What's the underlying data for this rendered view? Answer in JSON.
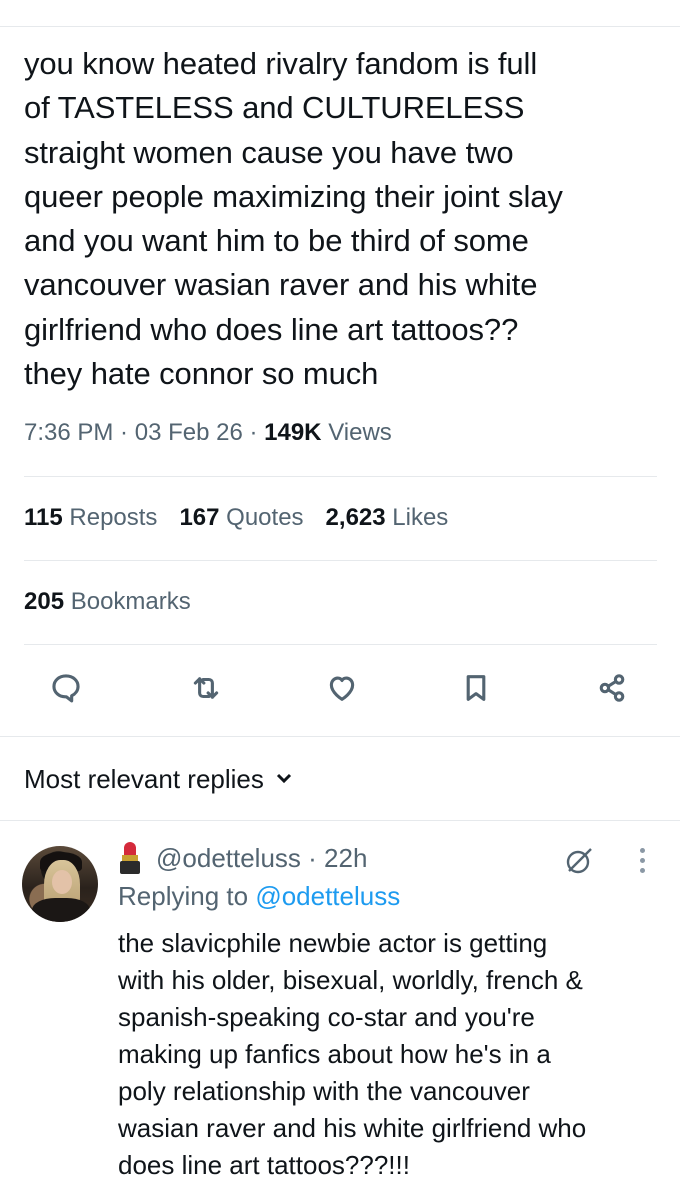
{
  "tweet": {
    "text": "you know heated rivalry fandom is full\nof TASTELESS and CULTURELESS\nstraight women cause you have two\nqueer people maximizing their joint slay\nand you want him to be third of some\nvancouver wasian raver and his white\ngirlfriend who does line art tattoos??\nthey hate connor so much",
    "time": "7:36 PM",
    "date": "03 Feb 26",
    "views_count": "149K",
    "views_label": "Views",
    "separator": " · "
  },
  "stats": {
    "reposts_count": "115",
    "reposts_label": "Reposts",
    "quotes_count": "167",
    "quotes_label": "Quotes",
    "likes_count": "2,623",
    "likes_label": "Likes",
    "bookmarks_count": "205",
    "bookmarks_label": "Bookmarks"
  },
  "actions": {
    "icons": [
      "reply-icon",
      "repost-icon",
      "like-icon",
      "bookmark-icon",
      "share-icon"
    ]
  },
  "replies": {
    "header_label": "Most relevant replies",
    "items": [
      {
        "handle": "@odetteluss",
        "age": "· 22h",
        "replying_prefix": "Replying to ",
        "replying_to": "@odetteluss",
        "text": "the slavicphile newbie actor is getting\nwith his older, bisexual, worldly, french &\nspanish-speaking co-star and you're\nmaking up fanfics about how he's in a\npoly relationship with the vancouver\nwasian raver and his white girlfriend who\ndoes line art tattoos???!!!"
      }
    ]
  },
  "colors": {
    "text": "#0f1419",
    "muted": "#536471",
    "link": "#1d9bf0",
    "divider": "#e6e9ec"
  }
}
